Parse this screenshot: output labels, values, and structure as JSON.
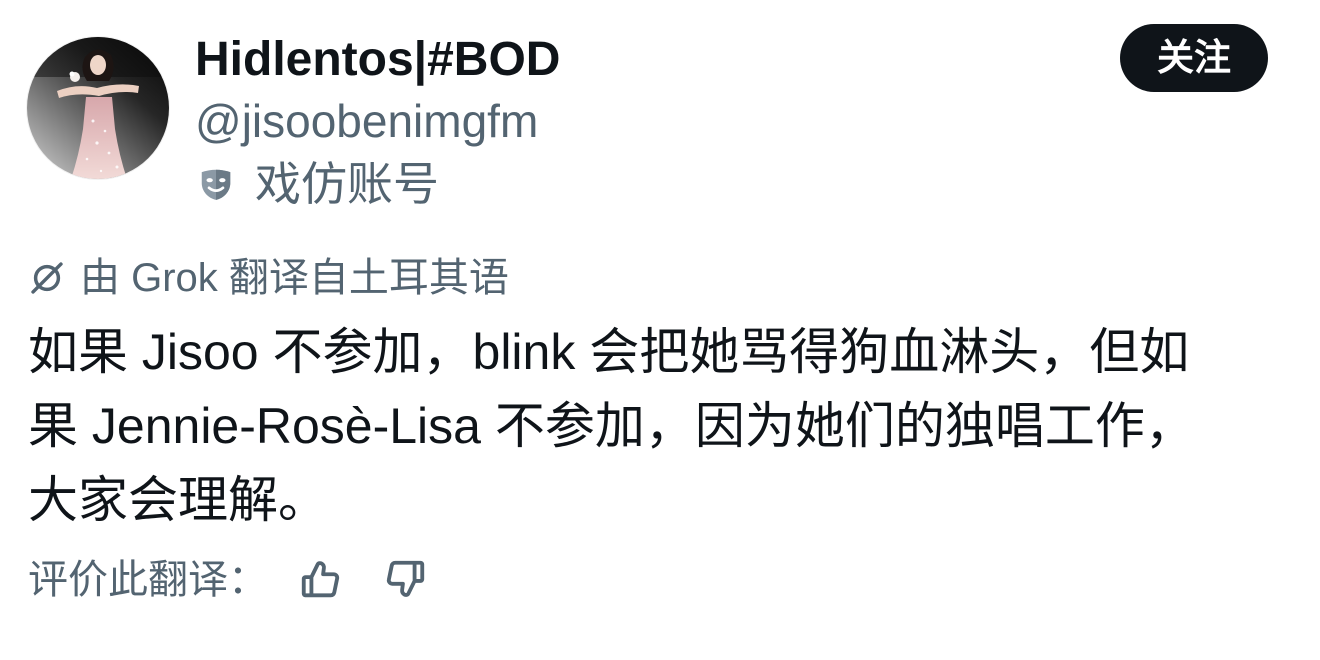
{
  "author": {
    "display_name": "Hidlentos|#BOD",
    "handle": "@jisoobenimgfm",
    "label_text": "戏仿账号"
  },
  "follow_button": {
    "label": "关注"
  },
  "translation": {
    "notice": "由 Grok 翻译自土耳其语"
  },
  "post": {
    "text": "如果 Jisoo 不参加，blink 会把她骂得狗血淋头，但如果 Jennie-Rosè-Lisa 不参加，因为她们的独唱工作，大家会理解。"
  },
  "rating": {
    "prompt": "评价此翻译："
  },
  "icons": {
    "parody_label": "parody-mask-icon",
    "translation": "grok-icon",
    "rate_up": "thumbs-up-icon",
    "rate_down": "thumbs-down-icon"
  },
  "colors": {
    "text_primary": "#0f1419",
    "text_secondary": "#536471",
    "button_background": "#0f1419",
    "button_text": "#ffffff",
    "background": "#ffffff"
  }
}
